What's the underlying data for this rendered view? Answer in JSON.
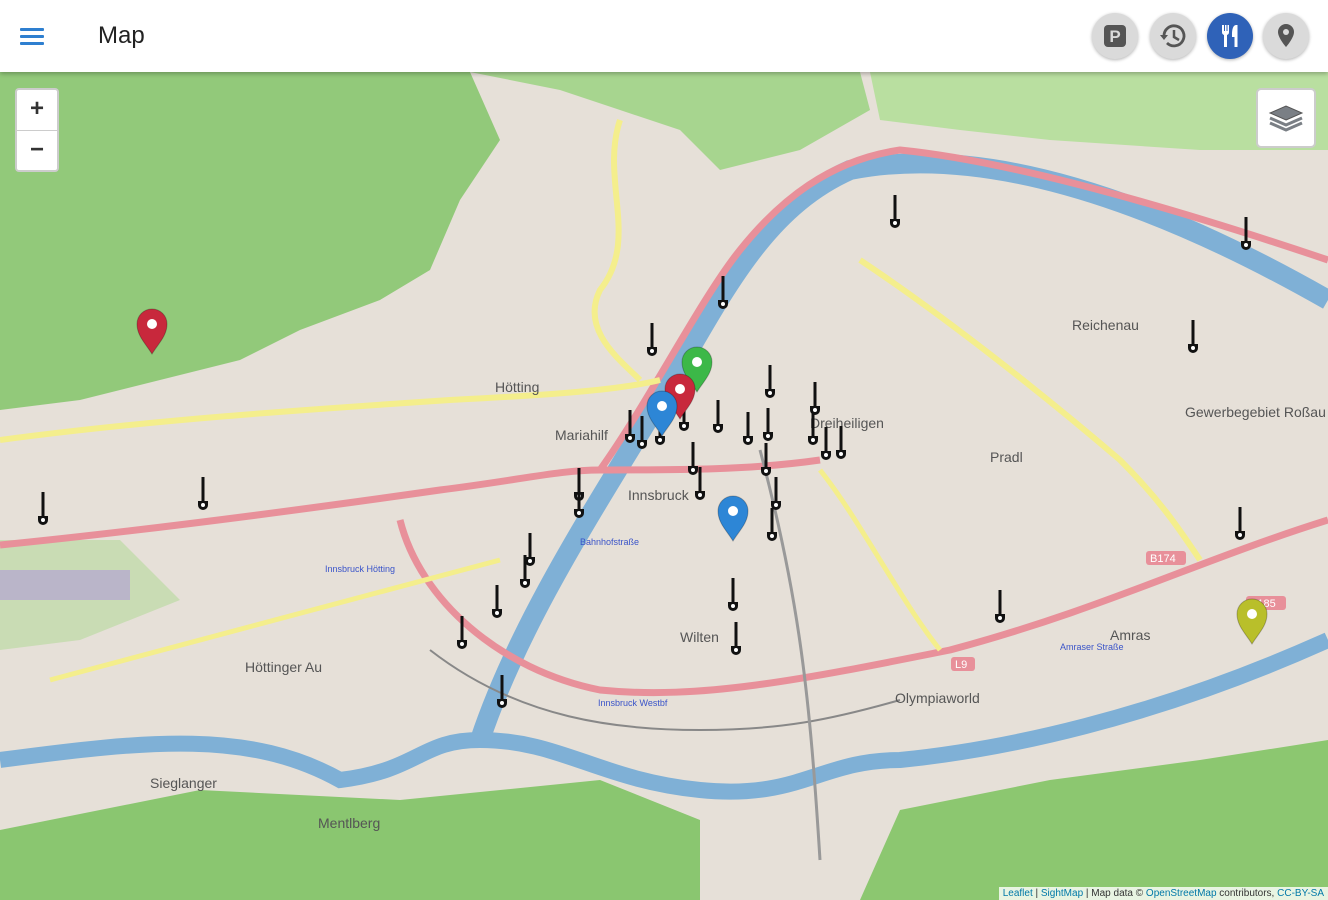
{
  "appbar": {
    "title": "Map",
    "menu_icon": "hamburger-menu-icon",
    "actions": [
      {
        "name": "parking-filter-button",
        "icon": "parking-icon",
        "active": false
      },
      {
        "name": "history-filter-button",
        "icon": "history-icon",
        "active": false
      },
      {
        "name": "restaurant-filter-button",
        "icon": "fork-knife-icon",
        "active": true
      },
      {
        "name": "places-filter-button",
        "icon": "location-pin-icon",
        "active": false
      }
    ],
    "accent_color": "#2f62b8"
  },
  "map": {
    "zoom_in_label": "+",
    "zoom_out_label": "−",
    "layers_icon": "layers-icon",
    "place_labels": [
      "Hötting",
      "Innsbruck",
      "Pradl",
      "Reichenau",
      "Wilten",
      "Höttinger Au",
      "Mentlberg",
      "Sieglanger",
      "Amras",
      "Olympiaworld",
      "Mariahilf",
      "Dreiheiligen",
      "Gewerbegebiet Roßau"
    ],
    "street_labels": [
      "Innsbruck Hötting",
      "Innsbruck Westbf",
      "Bahnhofstraße",
      "Amraser Straße"
    ],
    "road_labels": [
      "B174",
      "L9",
      "B185"
    ],
    "markers": {
      "red_pin_color": "#c8283c",
      "green_pin_color": "#3cb848",
      "blue_pin_color": "#2d86d6",
      "yellow_pin_color": "#b9bf2a"
    },
    "attribution": {
      "leaflet": "Leaflet",
      "sep1": " | ",
      "sightmap": "SightMap",
      "text": " | Map data © ",
      "osm": "OpenStreetMap",
      "contributors": " contributors, ",
      "license": "CC-BY-SA"
    }
  }
}
